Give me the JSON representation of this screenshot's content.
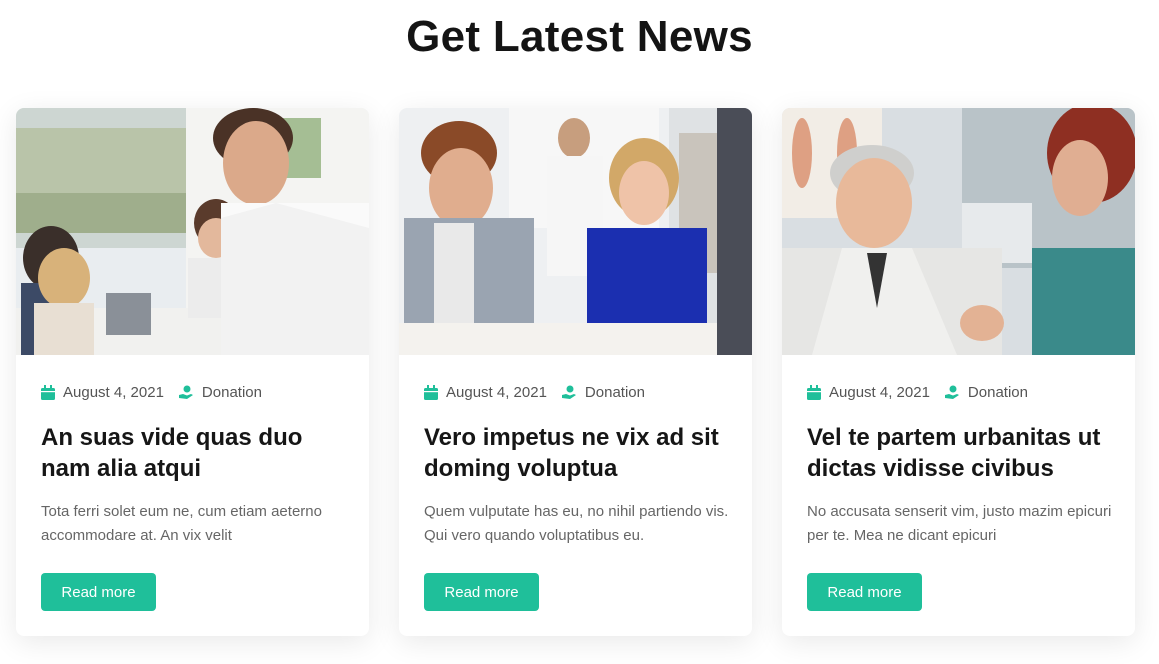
{
  "section": {
    "title": "Get Latest News"
  },
  "colors": {
    "accent": "#1fbf9a",
    "title": "#141414",
    "text": "#666666"
  },
  "cards": [
    {
      "image_alt": "Smiling man in white shirt at office meeting",
      "date": "August 4, 2021",
      "category": "Donation",
      "title": "An suas vide quas duo nam alia atqui",
      "excerpt": "Tota ferri solet eum ne, cum etiam aeterno accommodare at. An vix velit",
      "button": "Read more"
    },
    {
      "image_alt": "Colleagues talking at a desk in office",
      "date": "August 4, 2021",
      "category": "Donation",
      "title": "Vero impetus ne vix ad sit doming voluptua",
      "excerpt": "Quem vulputate has eu, no nihil partiendo vis. Qui vero quando voluptatibus eu.",
      "button": "Read more"
    },
    {
      "image_alt": "Older man talking with a woman in a clinic",
      "date": "August 4, 2021",
      "category": "Donation",
      "title": "Vel te partem urbanitas ut dictas vidisse civibus",
      "excerpt": "No accusata senserit vim, justo mazim epicuri per te. Mea ne dicant epicuri",
      "button": "Read more"
    }
  ]
}
